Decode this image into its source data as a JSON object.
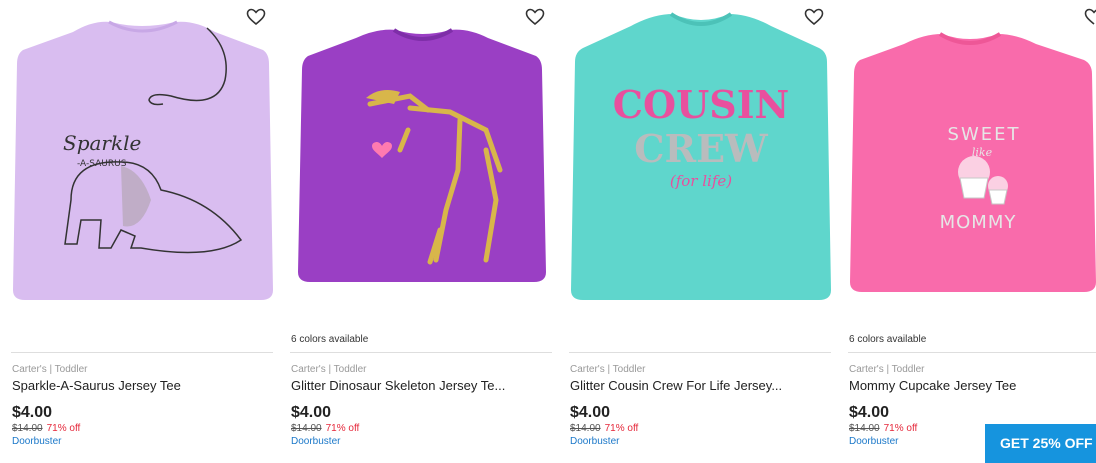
{
  "products": [
    {
      "brand": "Carter's | Toddler",
      "title": "Sparkle-A-Saurus Jersey Tee",
      "price": "$4.00",
      "was_price": "$14.00",
      "discount": "71% off",
      "tag": "Doorbuster",
      "colors_available": "",
      "shirt_color": "#d9bdf0",
      "print": {
        "line1": "Sparkle",
        "line2": "-A-SAURUS"
      },
      "icon": "heart-icon"
    },
    {
      "brand": "Carter's | Toddler",
      "title": "Glitter Dinosaur Skeleton Jersey Te...",
      "price": "$4.00",
      "was_price": "$14.00",
      "discount": "71% off",
      "tag": "Doorbuster",
      "colors_available": "6 colors available",
      "shirt_color": "#9a3fc4",
      "icon": "heart-icon"
    },
    {
      "brand": "Carter's | Toddler",
      "title": "Glitter Cousin Crew For Life Jersey...",
      "price": "$4.00",
      "was_price": "$14.00",
      "discount": "71% off",
      "tag": "Doorbuster",
      "colors_available": "",
      "shirt_color": "#5fd6cc",
      "print": {
        "line1": "COUSIN",
        "line2": "CREW",
        "line3": "(for life)"
      },
      "icon": "heart-icon"
    },
    {
      "brand": "Carter's | Toddler",
      "title": "Mommy Cupcake Jersey Tee",
      "price": "$4.00",
      "was_price": "$14.00",
      "discount": "71% off",
      "tag": "Doorbuster",
      "colors_available": "6 colors available",
      "shirt_color": "#f96bab",
      "print": {
        "line1": "SWEET",
        "line2": "like",
        "line3": "MOMMY"
      },
      "icon": "heart-icon"
    }
  ],
  "promo": {
    "label": "GET 25% OFF"
  },
  "colors": {
    "discount": "#e5273a",
    "tag": "#1b78c9",
    "promo_bg": "#1694de"
  }
}
